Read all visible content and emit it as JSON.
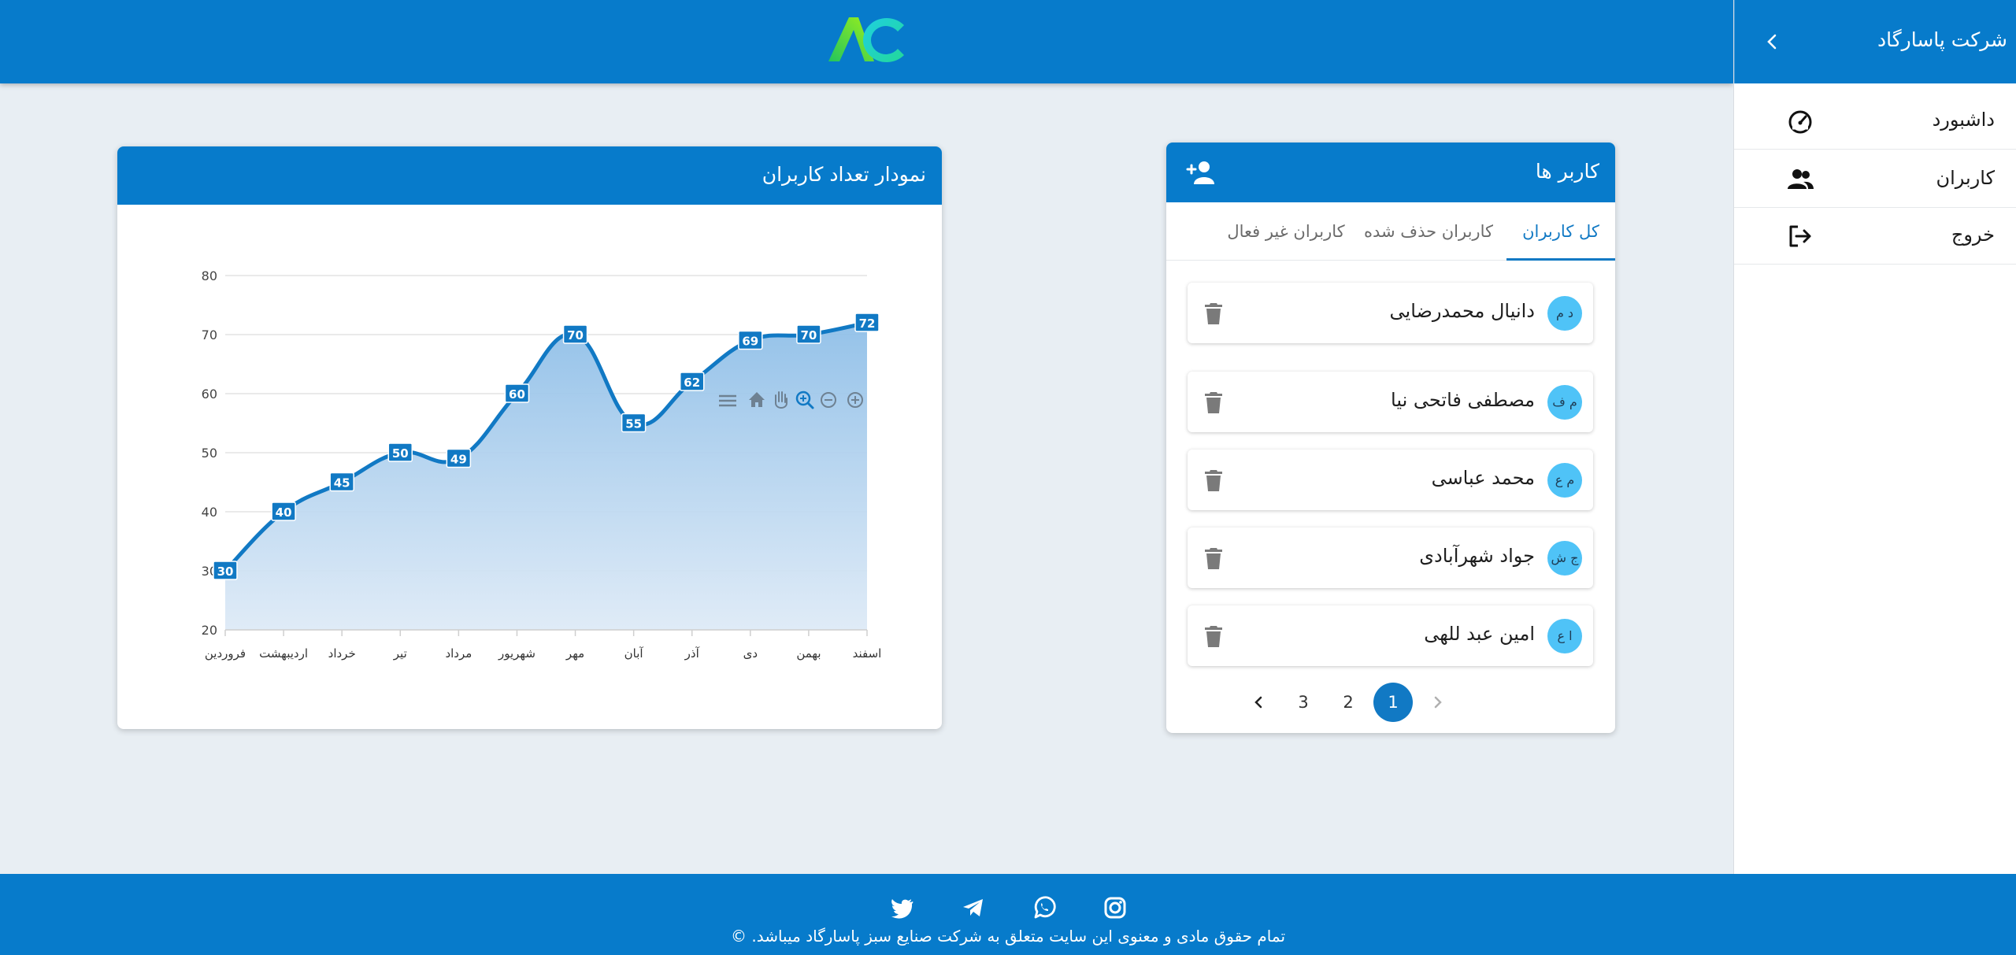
{
  "company": {
    "name": "شرکت پاسارگاد"
  },
  "brand": {
    "logo_text": "AC",
    "primary_color": "#077bcb",
    "logo_green": "#22c55e",
    "logo_cyan": "#1fd0e0"
  },
  "sidebar": {
    "items": [
      {
        "label": "داشبورد",
        "icon": "dashboard-gauge-icon"
      },
      {
        "label": "کاربران",
        "icon": "users-icon"
      },
      {
        "label": "خروج",
        "icon": "logout-icon"
      }
    ]
  },
  "users_card": {
    "title": "کاربر ها",
    "add_icon": "add-user-icon",
    "tabs": [
      {
        "label": "کل کاربران",
        "active": true
      },
      {
        "label": "کاربران حذف شده",
        "active": false
      },
      {
        "label": "کاربران غیر فعال",
        "active": false
      }
    ],
    "users": [
      {
        "initials": "د م",
        "name": "دانیال محمدرضایی"
      },
      {
        "initials": "م ف",
        "name": "مصطفی فاتحی نیا"
      },
      {
        "initials": "م ع",
        "name": "محمد عباسی"
      },
      {
        "initials": "ج ش",
        "name": "جواد شهرآبادی"
      },
      {
        "initials": "ا ع",
        "name": "امین عبد للهی"
      }
    ],
    "pagination": {
      "pages": [
        "1",
        "2",
        "3"
      ],
      "current": "1"
    }
  },
  "chart_card": {
    "title": "نمودار تعداد کاربران",
    "toolbar": [
      "zoom-in-icon",
      "zoom-out-icon",
      "zoom-selection-icon",
      "pan-hand-icon",
      "reset-home-icon",
      "menu-icon"
    ]
  },
  "chart_data": {
    "type": "area",
    "categories": [
      "فروردین",
      "اردیبهشت",
      "خرداد",
      "تیر",
      "مرداد",
      "شهریور",
      "مهر",
      "آبان",
      "آذر",
      "دی",
      "بهمن",
      "اسفند"
    ],
    "values": [
      30,
      40,
      45,
      50,
      49,
      60,
      70,
      55,
      62,
      69,
      70,
      72
    ],
    "ylim": [
      20,
      80
    ],
    "yticks": [
      "20",
      "30",
      "40",
      "50",
      "60",
      "70",
      "80"
    ],
    "grid": true,
    "data_labels": true,
    "line_color": "#1179c4",
    "fill_color": "#a9cdee"
  },
  "footer": {
    "copyright": "تمام حقوق مادی و معنوی این سایت متعلق به شرکت صنایع سبز پاسارگاد میباشد. ©",
    "social": [
      "instagram-icon",
      "whatsapp-icon",
      "telegram-icon",
      "twitter-icon"
    ]
  }
}
